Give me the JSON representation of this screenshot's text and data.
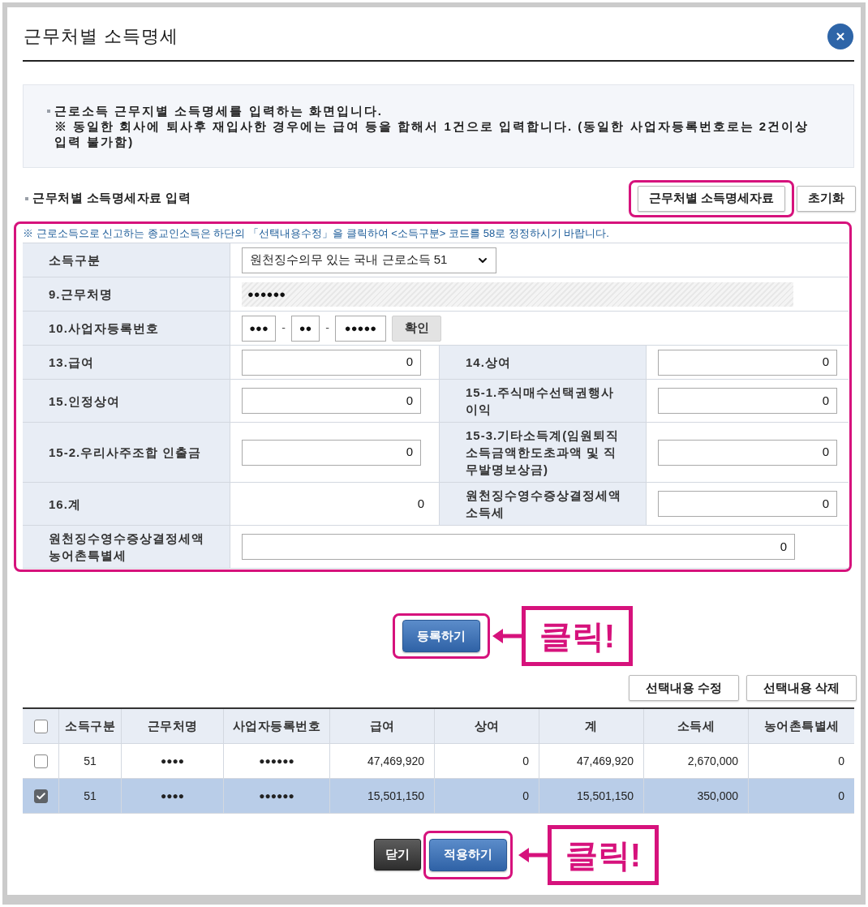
{
  "window": {
    "title": "근무처별 소득명세"
  },
  "notice": {
    "lines": [
      "근로소득 근무지별 소득명세를 입력하는 화면입니다.",
      "※ 동일한 회사에 퇴사후 재입사한 경우에는 급여 등을 합해서 1건으로 입력합니다. (동일한 사업자등록번호로는 2건이상 입력 불가함)"
    ]
  },
  "input_section": {
    "title": "근무처별 소득명세자료 입력",
    "buttons": [
      {
        "label": "근무처별 소득명세자료",
        "highlighted": true
      },
      {
        "label": "초기화",
        "highlighted": false
      }
    ]
  },
  "form": {
    "highlighted": true,
    "note": "※ 근로소득으로 신고하는 종교인소득은 하단의 「선택내용수정」을 클릭하여 <소득구분> 코드를 58로 정정하시기 바랍니다.",
    "rows": [
      {
        "fields": [
          {
            "kind": "select",
            "label": "소득구분",
            "value": "원천징수의무 있는 국내 근로소득 51"
          }
        ]
      },
      {
        "fields": [
          {
            "kind": "masked",
            "label": "9.근무처명",
            "value": "●●●●●●"
          }
        ]
      },
      {
        "fields": [
          {
            "kind": "biz_number",
            "label": "10.사업자등록번호",
            "parts": [
              "●●●",
              "●●",
              "●●●●●"
            ],
            "separators": [
              "-",
              "-"
            ],
            "button": "확인"
          }
        ]
      },
      {
        "fields": [
          {
            "kind": "amount",
            "label": "13.급여",
            "value": "0"
          },
          {
            "kind": "amount",
            "label": "14.상여",
            "value": "0"
          }
        ]
      },
      {
        "fields": [
          {
            "kind": "amount",
            "label": "15.인정상여",
            "value": "0"
          },
          {
            "kind": "amount",
            "label": "15-1.주식매수선택권행사이익",
            "value": "0"
          }
        ]
      },
      {
        "fields": [
          {
            "kind": "amount",
            "label": "15-2.우리사주조합 인출금",
            "value": "0"
          },
          {
            "kind": "amount",
            "label": "15-3.기타소득계(임원퇴직소득금액한도초과액 및 직무발명보상금)",
            "value": "0"
          }
        ]
      },
      {
        "fields": [
          {
            "kind": "display",
            "label": "16.계",
            "value": "0"
          },
          {
            "kind": "amount",
            "label": "원천징수영수증상결정세액소득세",
            "value": "0"
          }
        ]
      },
      {
        "fields": [
          {
            "kind": "amount",
            "label": "원천징수영수증상결정세액농어촌특별세",
            "value": "0"
          }
        ]
      }
    ]
  },
  "register": {
    "label": "등록하기",
    "highlighted": true,
    "callout": "클릭!"
  },
  "list": {
    "actions": [
      "선택내용 수정",
      "선택내용 삭제"
    ],
    "header_checked": false,
    "columns": [
      "소득구분",
      "근무처명",
      "사업자등록번호",
      "급여",
      "상여",
      "계",
      "소득세",
      "농어촌특별세"
    ],
    "rows": [
      {
        "checked": false,
        "selected": false,
        "cells": [
          "51",
          "●●●●",
          "●●●●●●",
          "47,469,920",
          "0",
          "47,469,920",
          "2,670,000",
          "0"
        ]
      },
      {
        "checked": true,
        "selected": true,
        "cells": [
          "51",
          "●●●●",
          "●●●●●●",
          "15,501,150",
          "0",
          "15,501,150",
          "350,000",
          "0"
        ]
      }
    ]
  },
  "footer": {
    "buttons": [
      {
        "label": "닫기",
        "kind": "dark",
        "highlighted": false
      },
      {
        "label": "적용하기",
        "kind": "primary",
        "highlighted": true,
        "callout": "클릭!"
      }
    ]
  }
}
